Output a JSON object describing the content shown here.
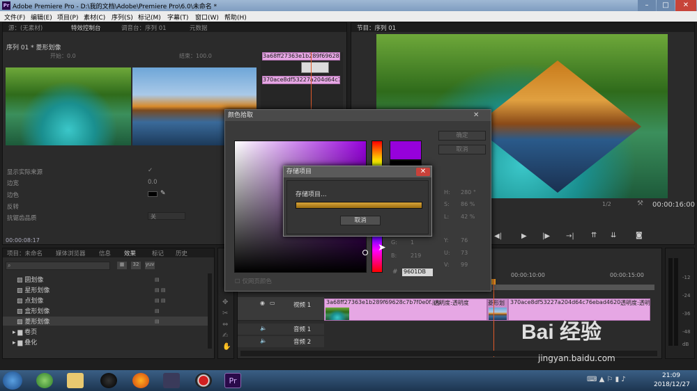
{
  "window": {
    "title": "Adobe Premiere Pro - D:\\我的文档\\Adobe\\Premiere Pro\\6.0\\未命名 *",
    "app_icon_text": "Pr"
  },
  "menu": [
    "文件(F)",
    "编辑(E)",
    "项目(P)",
    "素材(C)",
    "序列(S)",
    "标记(M)",
    "字幕(T)",
    "窗口(W)",
    "帮助(H)"
  ],
  "source_panel": {
    "tabs": [
      "源：(无素材)",
      "特效控制台",
      "调音台：序列 01",
      "元数据"
    ],
    "sequence_label": "序列 01 * 菱形划像",
    "start_label": "开始：0.0",
    "end_label": "结束：100.0",
    "timeline_clip_a": "3a68ff27363e1b289f69628c7b7f0e0f.jpg",
    "timeline_clip_b": "370ace8df53227a204d64c76ebad4620.jpg",
    "props": [
      {
        "label": "显示实际来源",
        "value": "✓"
      },
      {
        "label": "边宽",
        "value": "0.0"
      },
      {
        "label": "边色",
        "value": ""
      },
      {
        "label": "反转",
        "value": ""
      },
      {
        "label": "抗锯齿品质",
        "value": "关"
      }
    ],
    "timecode": "00:00:08:17"
  },
  "program_panel": {
    "tab": "节目：序列 01",
    "scale": "1/2",
    "timecode": "00:00:16:00"
  },
  "project_panel": {
    "tabs": [
      "项目：未命名",
      "媒体浏览器",
      "信息",
      "效果",
      "标记",
      "历史"
    ],
    "items": [
      "圆划像",
      "星形划像",
      "点划像",
      "盒形划像",
      "菱形划像"
    ],
    "folders": [
      "卷页",
      "叠化"
    ]
  },
  "color_picker": {
    "title": "颜色拾取",
    "ok": "确定",
    "cancel": "取消",
    "fields": [
      {
        "label": "H:",
        "value": "280 °"
      },
      {
        "label": "S:",
        "value": "86 %"
      },
      {
        "label": "L:",
        "value": "42 %"
      },
      {
        "label": "Y:",
        "value": "76"
      },
      {
        "label": "U:",
        "value": "73"
      },
      {
        "label": "V:",
        "value": "99"
      }
    ],
    "rgb": [
      {
        "label": "G:",
        "value": "1"
      },
      {
        "label": "B:",
        "value": "219"
      }
    ],
    "hex_label": "#",
    "hex": "9601DB",
    "web_colors": "仅网页颜色"
  },
  "save_dialog": {
    "title": "存储项目",
    "message": "存储项目...",
    "progress": 1.0,
    "cancel": "取消"
  },
  "timeline": {
    "ruler": [
      "00:00:10:00",
      "00:00:15:00"
    ],
    "tracks": [
      {
        "name": "视频 1"
      },
      {
        "name": "音频 1"
      },
      {
        "name": "音频 2"
      }
    ],
    "clip1_label": "3a68ff27363e1b289f69628c7b7f0e0f.jpg",
    "clip1_opacity": "透明度:透明度",
    "transition_label": "菱形划",
    "clip2_label": "370ace8df53227a204d64c76ebad4620.jpg",
    "clip2_opacity": "透明度:透明度",
    "meter_labels": [
      "-12",
      "-24",
      "-36",
      "-48",
      "dB"
    ]
  },
  "taskbar": {
    "time": "21:09",
    "date": "2018/12/27"
  },
  "watermark": {
    "brand": "Bai 经验",
    "url": "jingyan.baidu.com"
  },
  "colors": {
    "picked": "#9601DB",
    "clip": "#e6a7e4",
    "progress": "#b8860b",
    "playhead": "#e05a2a"
  }
}
